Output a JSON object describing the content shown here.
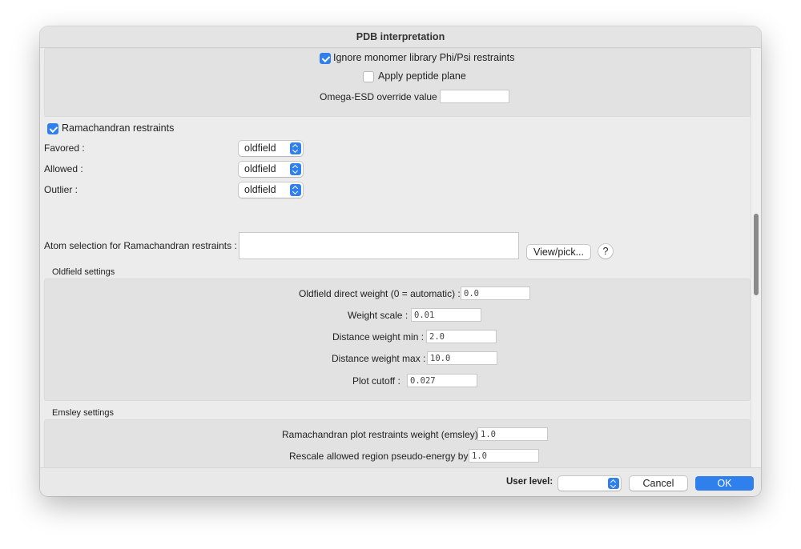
{
  "window": {
    "title": "PDB interpretation"
  },
  "top_panel": {
    "ignore_phipsi": {
      "label": "Ignore monomer library Phi/Psi restraints",
      "checked": true
    },
    "apply_peptide_plane": {
      "label": "Apply peptide plane",
      "checked": false
    },
    "omega_esd": {
      "label": "Omega-ESD override value :",
      "value": ""
    }
  },
  "ramachandran": {
    "label": "Ramachandran restraints",
    "checked": true,
    "favored": {
      "label": "Favored :",
      "value": "oldfield"
    },
    "allowed": {
      "label": "Allowed :",
      "value": "oldfield"
    },
    "outlier": {
      "label": "Outlier :",
      "value": "oldfield"
    },
    "atom_selection": {
      "label": "Atom selection for Ramachandran restraints :",
      "value": ""
    },
    "view_pick_label": "View/pick...",
    "help_label": "?"
  },
  "oldfield": {
    "title": "Oldfield settings",
    "direct_weight": {
      "label": "Oldfield direct weight (0 = automatic) :",
      "value": "0.0"
    },
    "weight_scale": {
      "label": "Weight scale :",
      "value": "0.01"
    },
    "dist_min": {
      "label": "Distance weight min :",
      "value": "2.0"
    },
    "dist_max": {
      "label": "Distance weight max :",
      "value": "10.0"
    },
    "plot_cutoff": {
      "label": "Plot cutoff :",
      "value": "0.027"
    }
  },
  "emsley": {
    "title": "Emsley settings",
    "weight": {
      "label": "Ramachandran plot restraints weight (emsley) :",
      "value": "1.0"
    },
    "rescale": {
      "label": "Rescale allowed region pseudo-energy by :",
      "value": "1.0"
    }
  },
  "footer": {
    "user_level_label": "User level:",
    "user_level_value": "",
    "cancel_label": "Cancel",
    "ok_label": "OK"
  },
  "colors": {
    "accent": "#2f7fed",
    "panel": "#e2e2e2",
    "window": "#e9e9e9"
  },
  "icons": {
    "checkbox": "checkmark-icon",
    "select": "updown-chevron-icon"
  }
}
